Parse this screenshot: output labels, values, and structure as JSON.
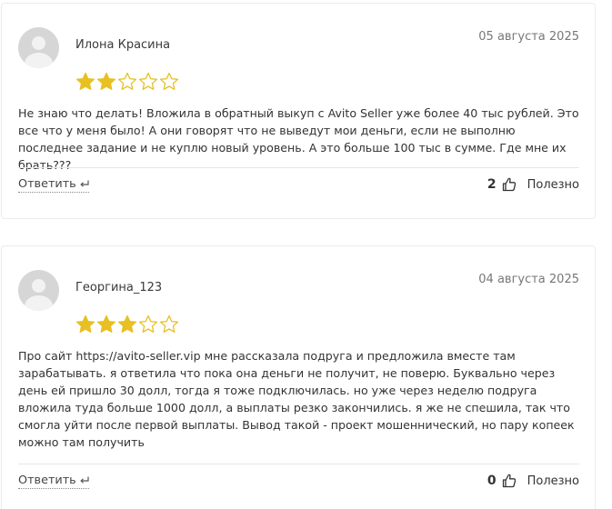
{
  "colors": {
    "star_filled": "#e8c021",
    "star_empty_outline": "#e8c021",
    "avatar_bg": "#d6d6d6"
  },
  "icons": {
    "avatar": "user-avatar-placeholder",
    "reply": "reply-arrow-icon",
    "like": "thumbs-up-icon",
    "star": "star-icon"
  },
  "reviews": [
    {
      "author": "Илона Красина",
      "date": "05 августа 2025",
      "rating": 2,
      "max_rating": 5,
      "text": "Не знаю что делать! Вложила в обратный выкуп с Avito Seller уже более 40 тыс рублей. Это все что у меня было! А они говорят что не выведут мои деньги, если не выполню последнее задание и не куплю новый уровень. А это больше 100 тыс в сумме. Где мне их брать???",
      "reply_label": "Ответить",
      "votes": "2",
      "useful_label": "Полезно"
    },
    {
      "author": "Георгина_123",
      "date": "04 августа 2025",
      "rating": 3,
      "max_rating": 5,
      "text": "Про сайт https://avito-seller.vip мне рассказала подруга и предложила вместе там зарабатывать. я ответила что пока она деньги не получит, не поверю. Буквально через день ей пришло 30 долл, тогда я тоже подключилась. но уже через неделю подруга вложила туда больше 1000 долл, а выплаты резко закончились. я же не спешила, так что смогла уйти после первой выплаты. Вывод такой - проект мошеннический, но пару копеек можно там получить",
      "reply_label": "Ответить",
      "votes": "0",
      "useful_label": "Полезно"
    }
  ]
}
